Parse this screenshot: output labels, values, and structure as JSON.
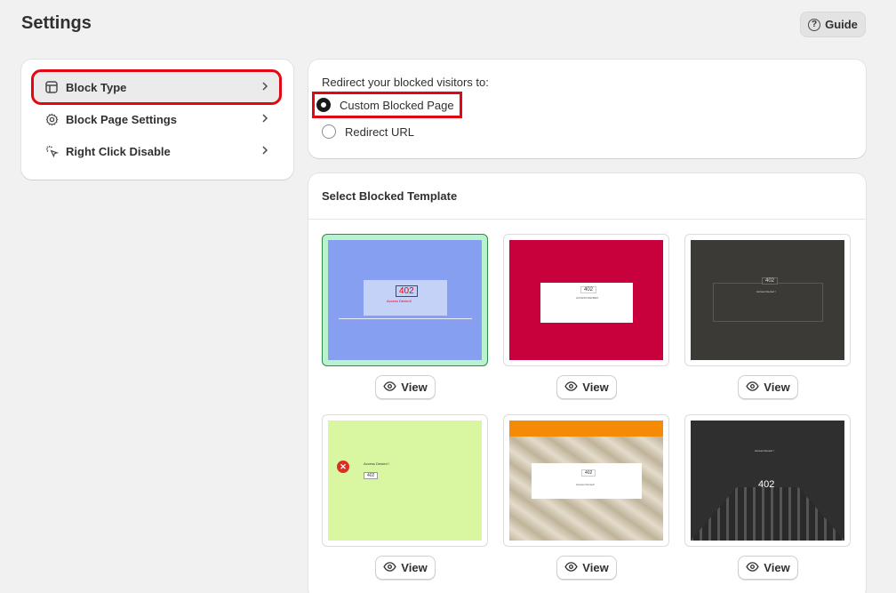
{
  "header": {
    "title": "Settings",
    "guide_label": "Guide"
  },
  "nav": {
    "items": [
      {
        "label": "Block Type",
        "icon": "layout-icon",
        "active": true
      },
      {
        "label": "Block Page Settings",
        "icon": "gear-icon",
        "active": false
      },
      {
        "label": "Right Click Disable",
        "icon": "cursor-click-icon",
        "active": false
      }
    ]
  },
  "redirect": {
    "title": "Redirect your blocked visitors to:",
    "options": [
      {
        "label": "Custom Blocked Page",
        "checked": true
      },
      {
        "label": "Redirect URL",
        "checked": false
      }
    ]
  },
  "templates": {
    "title": "Select Blocked Template",
    "view_label": "View",
    "items": [
      {
        "bg": "#869ff0",
        "code": "402",
        "heading": "Access Denied!",
        "selected": true
      },
      {
        "bg": "#c8003c",
        "code": "402",
        "heading": "ACCESS DENIED!",
        "selected": false
      },
      {
        "bg": "#3b3a36",
        "code": "402",
        "heading": "Access Denied !",
        "selected": false
      },
      {
        "bg": "#d9f7a1",
        "code": "402",
        "heading": "Access Denied !",
        "selected": false
      },
      {
        "bg": "#cbbfa8",
        "code": "402",
        "heading": "Access Denied!",
        "selected": false
      },
      {
        "bg": "#2f2f2f",
        "code": "402",
        "heading": "Access Denied !",
        "selected": false
      }
    ]
  }
}
